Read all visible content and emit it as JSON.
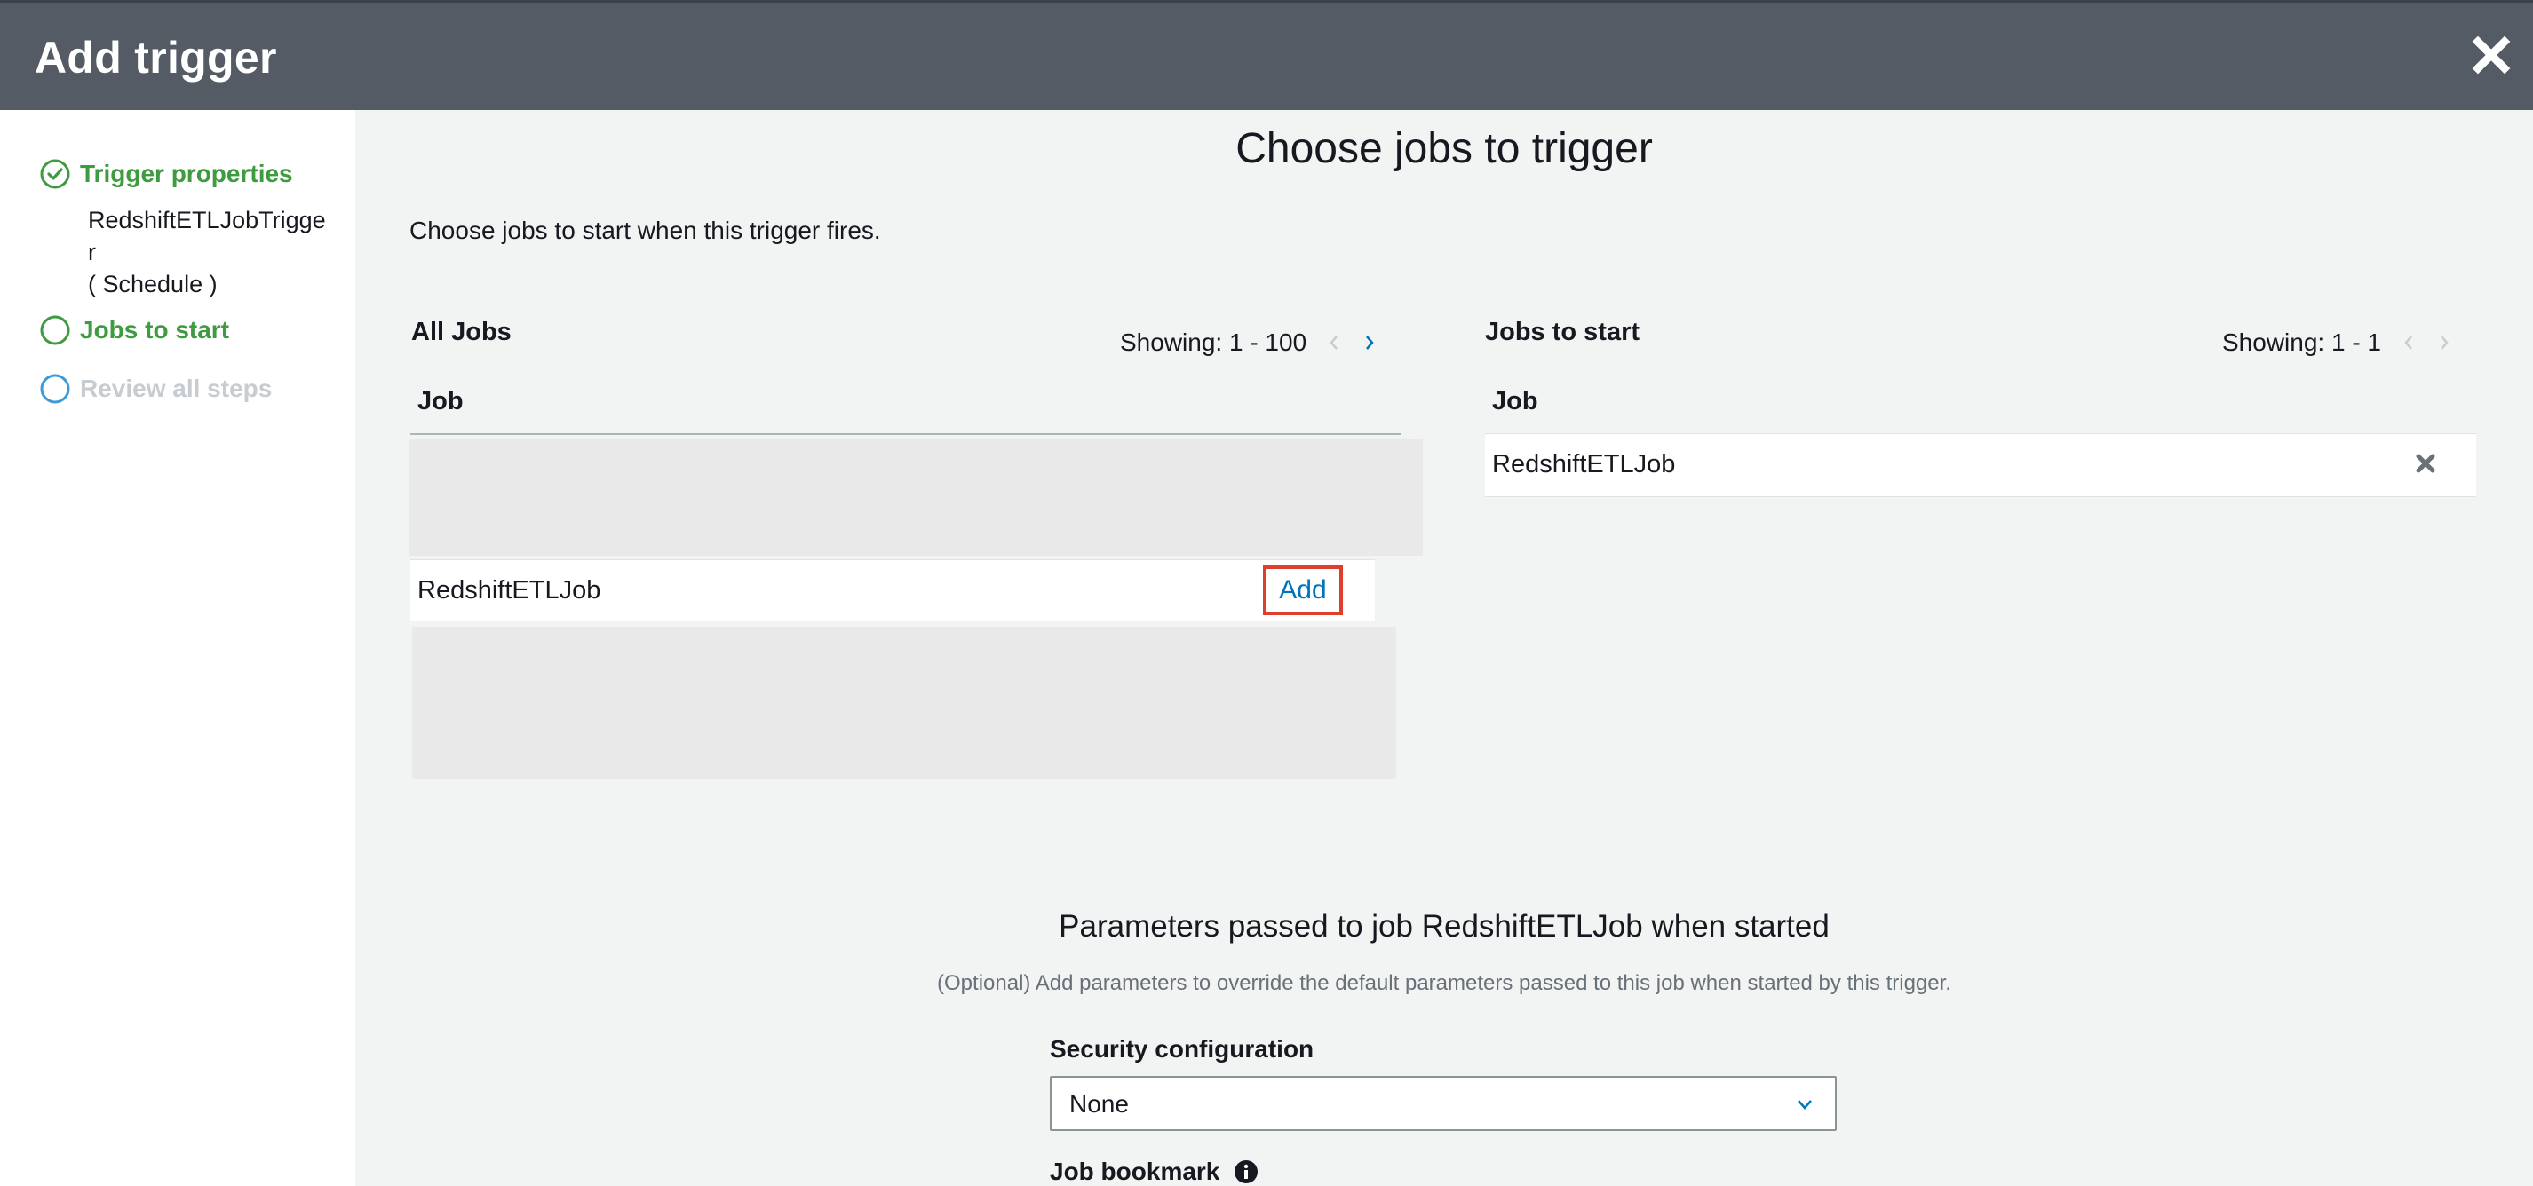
{
  "header": {
    "title": "Add trigger"
  },
  "sidebar": {
    "steps": [
      {
        "label": "Trigger properties",
        "sub_lines": [
          "RedshiftETLJobTrigge",
          "r",
          "( Schedule )"
        ]
      },
      {
        "label": "Jobs to start"
      },
      {
        "label": "Review all steps"
      }
    ]
  },
  "main": {
    "title": "Choose jobs to trigger",
    "intro": "Choose jobs to start when this trigger fires.",
    "all_jobs": {
      "title": "All Jobs",
      "showing": "Showing: 1 - 100",
      "column": "Job",
      "rows": [
        {
          "name": "RedshiftETLJob",
          "action": "Add"
        }
      ]
    },
    "jobs_to_start": {
      "title": "Jobs to start",
      "showing": "Showing: 1 - 1",
      "column": "Job",
      "rows": [
        {
          "name": "RedshiftETLJob"
        }
      ]
    },
    "params": {
      "title": "Parameters passed to job RedshiftETLJob when started",
      "description": "(Optional) Add parameters to override the default parameters passed to this job when started by this trigger.",
      "security_label": "Security configuration",
      "security_value": "None",
      "bookmark_label": "Job bookmark"
    }
  },
  "colors": {
    "header": "#545b64",
    "success": "#3f9b3f",
    "link": "#0073bb",
    "highlight": "#e03e2d",
    "todo": "#c7ccd1"
  },
  "icons": [
    "close-icon",
    "check-circle-icon",
    "circle-icon",
    "chevron-left-icon",
    "chevron-right-icon",
    "remove-icon",
    "chevron-down-icon",
    "info-icon"
  ]
}
